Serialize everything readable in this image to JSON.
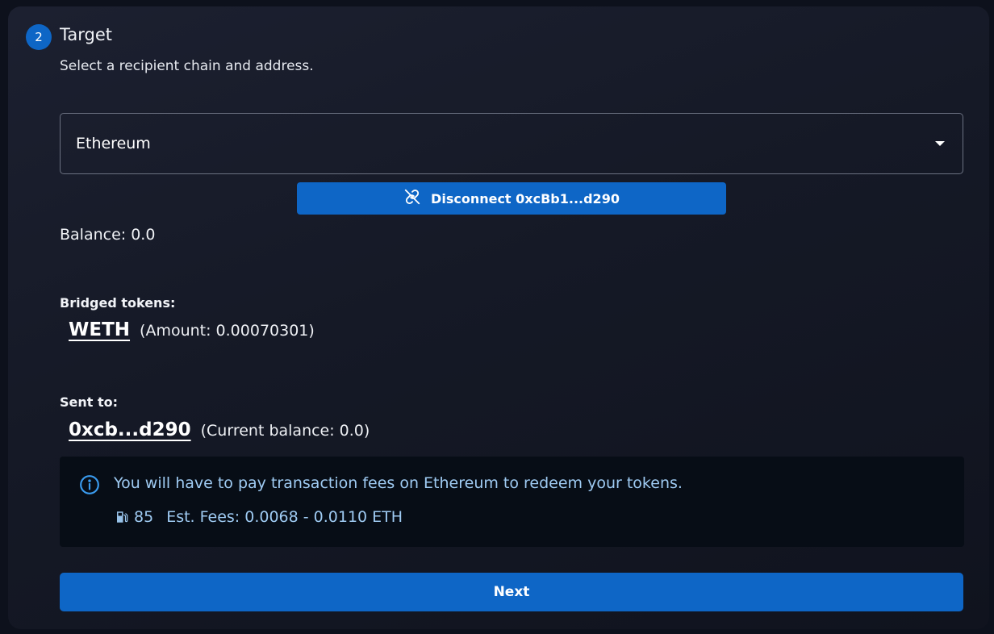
{
  "step": {
    "number": "2",
    "title": "Target",
    "description": "Select a recipient chain and address."
  },
  "chain_select": {
    "value": "Ethereum"
  },
  "disconnect_button": {
    "label": "Disconnect 0xcBb1...d290",
    "icon": "link-off-icon"
  },
  "balance": {
    "text": "Balance: 0.0"
  },
  "bridged": {
    "label": "Bridged tokens:",
    "token": "WETH",
    "amount_text": "(Amount: 0.00070301)"
  },
  "sent": {
    "label": "Sent to:",
    "address": "0xcb...d290",
    "balance_text": "(Current balance: 0.0)"
  },
  "info": {
    "icon": "info-icon",
    "message": "You will have to pay transaction fees on Ethereum to redeem your tokens.",
    "gas_icon": "gas-pump-icon",
    "gas_value": "85",
    "fees_text": "Est. Fees: 0.0068 - 0.0110 ETH"
  },
  "next_button": {
    "label": "Next"
  },
  "colors": {
    "accent": "#0e66c6",
    "info_text": "#9fcbf3",
    "info_background": "#070d16"
  }
}
